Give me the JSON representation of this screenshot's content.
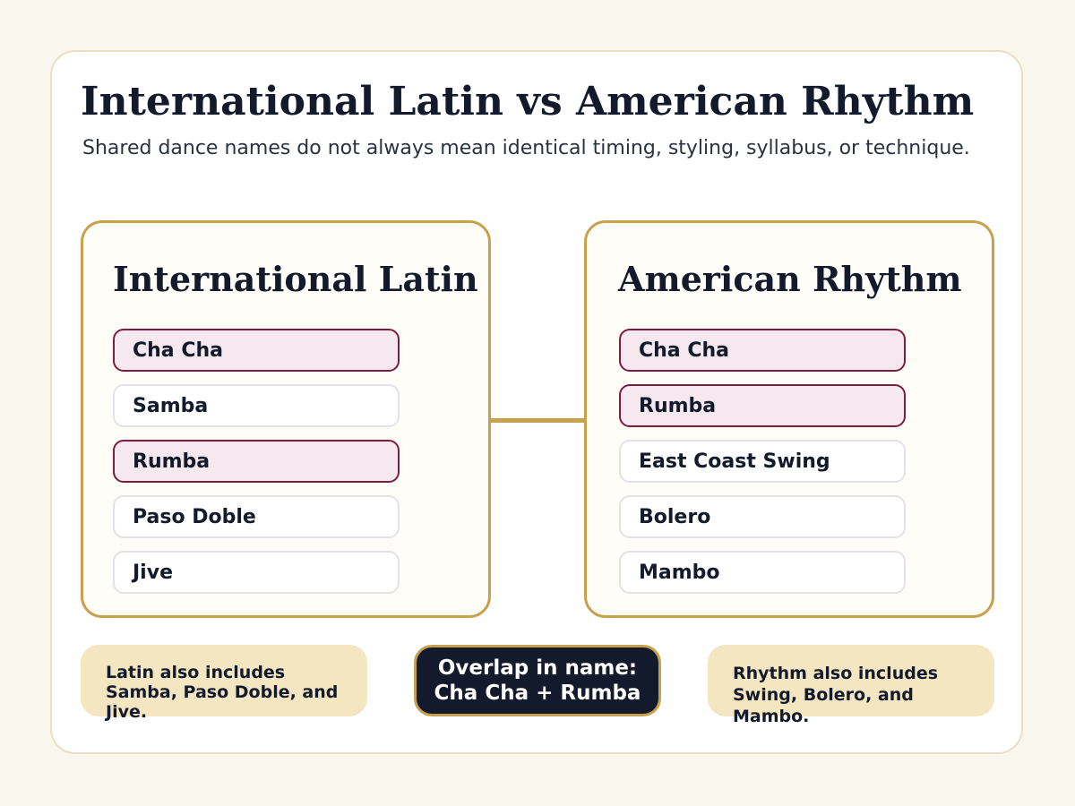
{
  "title": "International Latin vs American Rhythm",
  "subtitle": "Shared dance names do not always mean identical timing, styling, syllabus, or technique.",
  "colors": {
    "accent_gold": "#c7a14d",
    "shared_border": "#7b1d3f",
    "shared_fill": "#f5e8ee",
    "note_fill": "#f5e6c2",
    "overlap_fill": "#121a2b"
  },
  "panels": [
    {
      "title": "International Latin",
      "dances": [
        {
          "name": "Cha Cha",
          "shared": true
        },
        {
          "name": "Samba",
          "shared": false
        },
        {
          "name": "Rumba",
          "shared": true
        },
        {
          "name": "Paso Doble",
          "shared": false
        },
        {
          "name": "Jive",
          "shared": false
        }
      ]
    },
    {
      "title": "American Rhythm",
      "dances": [
        {
          "name": "Cha Cha",
          "shared": true
        },
        {
          "name": "Rumba",
          "shared": true
        },
        {
          "name": "East Coast Swing",
          "shared": false
        },
        {
          "name": "Bolero",
          "shared": false
        },
        {
          "name": "Mambo",
          "shared": false
        }
      ]
    }
  ],
  "notes": {
    "left": "Latin also includes Samba, Paso Doble, and Jive.",
    "right": "Rhythm also includes Swing, Bolero, and Mambo.",
    "overlap_line1": "Overlap in name:",
    "overlap_line2": "Cha Cha + Rumba"
  }
}
